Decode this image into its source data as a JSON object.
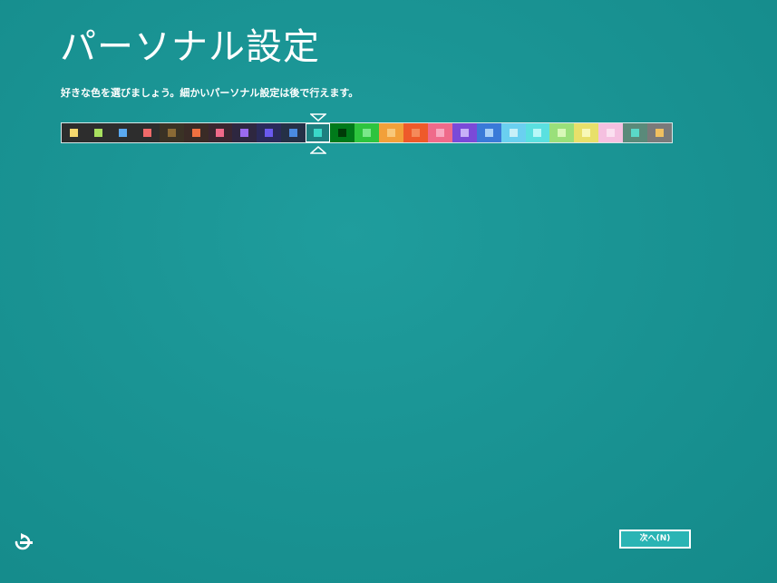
{
  "header": {
    "title": "パーソナル設定",
    "subtitle": "好きな色を選びましょう。細かいパーソナル設定は後で行えます。"
  },
  "palette": {
    "selected_index": 10,
    "swatches": [
      {
        "bg": "#2d2d2d",
        "chip": "#f5d76e"
      },
      {
        "bg": "#2d2d2d",
        "chip": "#a8e05f"
      },
      {
        "bg": "#2d2d2d",
        "chip": "#5aa9f0"
      },
      {
        "bg": "#2d2d2d",
        "chip": "#ef6a6a"
      },
      {
        "bg": "#3a3225",
        "chip": "#8a6a35"
      },
      {
        "bg": "#3a2b26",
        "chip": "#ef7040"
      },
      {
        "bg": "#3a2630",
        "chip": "#ef6a8a"
      },
      {
        "bg": "#2e2740",
        "chip": "#9a6aef"
      },
      {
        "bg": "#2a2a5a",
        "chip": "#6a5aef"
      },
      {
        "bg": "#253046",
        "chip": "#4a8ae0"
      },
      {
        "bg": "#1d7f7f",
        "chip": "#3ad8c8"
      },
      {
        "bg": "#007a1a",
        "chip": "#003a08"
      },
      {
        "bg": "#2ec43e",
        "chip": "#7ae88a"
      },
      {
        "bg": "#f2a03a",
        "chip": "#f8c87a"
      },
      {
        "bg": "#ee5a2a",
        "chip": "#f58a5a"
      },
      {
        "bg": "#ef6a8a",
        "chip": "#f8a8c0"
      },
      {
        "bg": "#7a4ad8",
        "chip": "#c8b0f8"
      },
      {
        "bg": "#3a7ad8",
        "chip": "#a8d0f8"
      },
      {
        "bg": "#6ad0f0",
        "chip": "#c8f0f8"
      },
      {
        "bg": "#5ae0e0",
        "chip": "#b8f8f8"
      },
      {
        "bg": "#9ae07a",
        "chip": "#d8f8b8"
      },
      {
        "bg": "#e8e06a",
        "chip": "#f8f8b8"
      },
      {
        "bg": "#f5c0e0",
        "chip": "#fbe0f0"
      },
      {
        "bg": "#5a8a7a",
        "chip": "#5ad8c8"
      },
      {
        "bg": "#7a7a7a",
        "chip": "#f0c060"
      }
    ]
  },
  "footer": {
    "next_label": "次へ(N)"
  }
}
